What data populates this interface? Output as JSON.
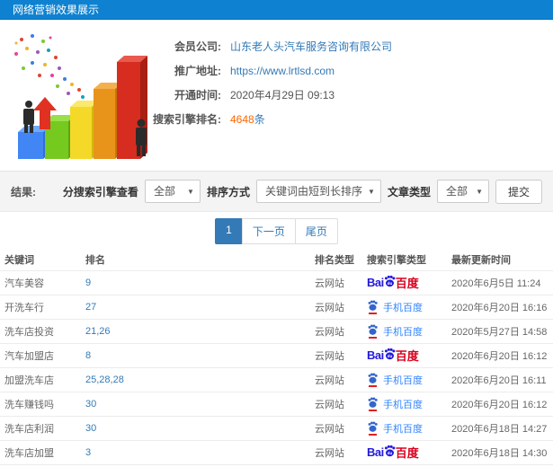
{
  "header": {
    "title": "网络营销效果展示"
  },
  "info": {
    "fields": [
      {
        "label": "会员公司:",
        "value": "山东老人头汽车服务咨询有限公司"
      },
      {
        "label": "推广地址:",
        "value": "https://www.lrtlsd.com"
      },
      {
        "label": "开通时间:",
        "value": "2020年4月29日 09:13"
      },
      {
        "label": "搜索引擎排名:",
        "count": "4648",
        "unit": "条"
      }
    ],
    "illustration": "3d-bar-chart-growth"
  },
  "filters": {
    "result_label": "结果:",
    "engine_select": {
      "label": "分搜索引擎查看",
      "value": "全部"
    },
    "sort_select": {
      "label": "排序方式",
      "value": "关键词由短到长排序"
    },
    "article_select": {
      "label": "文章类型",
      "value": "全部"
    },
    "submit_label": "提交"
  },
  "pagination": {
    "current": "1",
    "next_label": "下一页",
    "last_label": "尾页"
  },
  "table": {
    "headers": [
      "关键词",
      "排名",
      "排名类型",
      "搜索引擎类型",
      "最新更新时间"
    ],
    "engine_labels": {
      "baidu_bai": "Bai",
      "baidu_du": "du",
      "baidu_cn": "百度",
      "mobile_baidu": "手机百度"
    },
    "rows": [
      {
        "keyword": "汽车美容",
        "rank": "9",
        "rank_type": "云网站",
        "engine": "baidu",
        "updated": "2020年6月5日 11:24"
      },
      {
        "keyword": "开洗车行",
        "rank": "27",
        "rank_type": "云网站",
        "engine": "mobile-baidu",
        "updated": "2020年6月20日 16:16"
      },
      {
        "keyword": "洗车店投资",
        "rank": "21,26",
        "rank_type": "云网站",
        "engine": "mobile-baidu",
        "updated": "2020年5月27日 14:58"
      },
      {
        "keyword": "汽车加盟店",
        "rank": "8",
        "rank_type": "云网站",
        "engine": "baidu",
        "updated": "2020年6月20日 16:12"
      },
      {
        "keyword": "加盟洗车店",
        "rank": "25,28,28",
        "rank_type": "云网站",
        "engine": "mobile-baidu",
        "updated": "2020年6月20日 16:11"
      },
      {
        "keyword": "洗车赚钱吗",
        "rank": "30",
        "rank_type": "云网站",
        "engine": "mobile-baidu",
        "updated": "2020年6月20日 16:12"
      },
      {
        "keyword": "洗车店利润",
        "rank": "30",
        "rank_type": "云网站",
        "engine": "mobile-baidu",
        "updated": "2020年6月18日 14:27"
      },
      {
        "keyword": "洗车店加盟",
        "rank": "3",
        "rank_type": "云网站",
        "engine": "baidu",
        "updated": "2020年6月18日 14:30"
      }
    ]
  },
  "colors": {
    "header_bg": "#0e82d0",
    "link_blue": "#337ab7",
    "rank_count_orange": "#ff6600",
    "baidu_blue": "#2319dc",
    "baidu_red": "#d9001d",
    "mobile_baidu_blue": "#3385ff"
  }
}
